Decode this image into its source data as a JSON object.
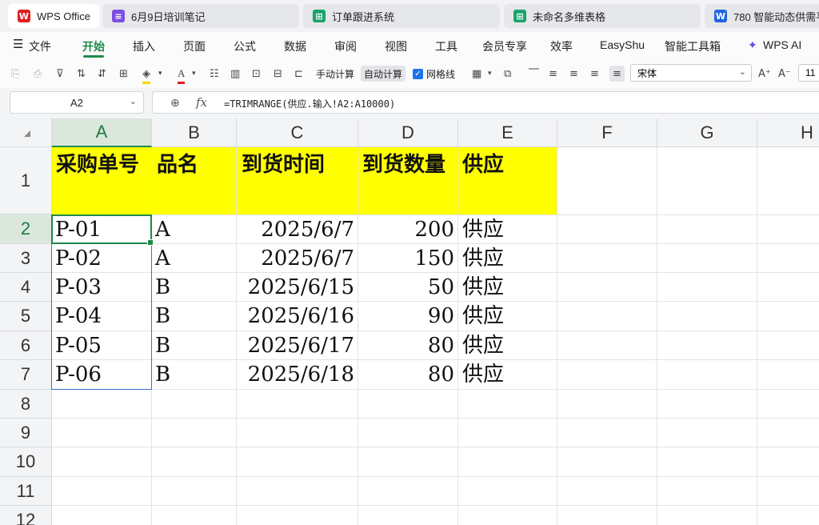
{
  "tabs": [
    {
      "label": "WPS Office",
      "icon": "wps-logo-icon",
      "color": "#e02020",
      "glyph": "W"
    },
    {
      "label": "6月9日培训笔记",
      "icon": "note-doc-icon",
      "color": "#7b4fe0",
      "glyph": "≡"
    },
    {
      "label": "订单跟进系统",
      "icon": "table-app-icon",
      "color": "#1aa36b",
      "glyph": "⊞"
    },
    {
      "label": "未命名多维表格",
      "icon": "table-app-icon",
      "color": "#1aa36b",
      "glyph": "⊞"
    },
    {
      "label": "780 智能动态供需平",
      "icon": "word-doc-icon",
      "color": "#2266dd",
      "glyph": "W"
    }
  ],
  "menu": {
    "file": "文件",
    "items": [
      "开始",
      "插入",
      "页面",
      "公式",
      "数据",
      "审阅",
      "视图",
      "工具",
      "会员专享",
      "效率",
      "EasyShu",
      "智能工具箱"
    ],
    "ai": "WPS AI",
    "active": "开始"
  },
  "toolbar": {
    "manual_calc": "手动计算",
    "auto_calc": "自动计算",
    "gridlines": "网格线",
    "font_name": "宋体",
    "font_size": "11"
  },
  "formula_bar": {
    "name_box": "A2",
    "formula": "=TRIMRANGE(供应.输入!A2:A10000)"
  },
  "sheet": {
    "columns": [
      "A",
      "B",
      "C",
      "D",
      "E",
      "F",
      "G",
      "H"
    ],
    "rows": [
      "1",
      "2",
      "3",
      "4",
      "5",
      "6",
      "7",
      "8",
      "9",
      "10",
      "11",
      "12"
    ],
    "header": [
      "采购单号",
      "品名",
      "到货时间",
      "到货数量",
      "供应"
    ],
    "data": [
      [
        "P-01",
        "A",
        "2025/6/7",
        "200",
        "供应"
      ],
      [
        "P-02",
        "A",
        "2025/6/7",
        "150",
        "供应"
      ],
      [
        "P-03",
        "B",
        "2025/6/15",
        "50",
        "供应"
      ],
      [
        "P-04",
        "B",
        "2025/6/16",
        "90",
        "供应"
      ],
      [
        "P-05",
        "B",
        "2025/6/17",
        "80",
        "供应"
      ],
      [
        "P-06",
        "B",
        "2025/6/18",
        "80",
        "供应"
      ]
    ],
    "selected_cell": "A2",
    "highlight_color": "#ffff00",
    "accent_color": "#1e8a4a"
  }
}
